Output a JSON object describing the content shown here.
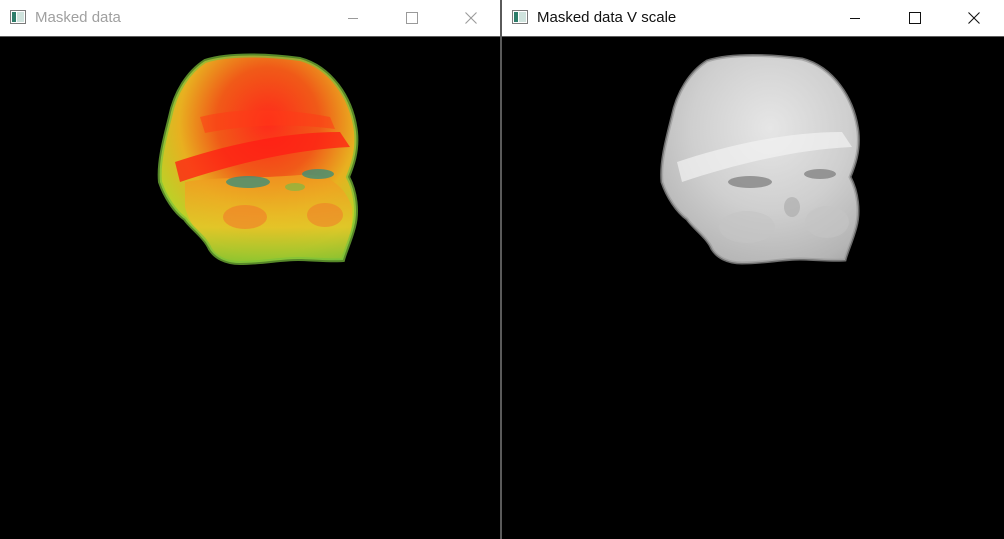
{
  "windows": [
    {
      "title": "Masked data",
      "active": false,
      "icon": "app-image-icon",
      "controls": [
        "minimize-icon",
        "maximize-icon",
        "close-icon"
      ],
      "image": "colormapped masked face",
      "colors": {
        "hot": "#ff2a1a",
        "mid": "#f07a15",
        "cool": "#9ad22a",
        "edge": "#6fb834"
      }
    },
    {
      "title": "Masked data V scale",
      "active": true,
      "icon": "app-image-icon",
      "controls": [
        "minimize-icon",
        "maximize-icon",
        "close-icon"
      ],
      "image": "grayscale masked face",
      "colors": {
        "light": "#dadada",
        "mid": "#b8b8b8",
        "dark": "#8a8a8a"
      }
    }
  ]
}
